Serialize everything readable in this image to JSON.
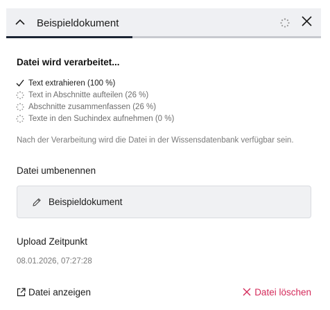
{
  "header": {
    "title": "Beispieldokument",
    "progress": 0.4,
    "icons": {
      "collapse": "chevron-up-icon",
      "status": "loading-spinner-icon",
      "close": "close-icon"
    }
  },
  "processing": {
    "title": "Datei wird verarbeitet...",
    "steps": [
      {
        "label": "Text extrahieren (100 %)",
        "status": "done",
        "icon": "checkmark-icon"
      },
      {
        "label": "Text in Abschnitte aufteilen (26 %)",
        "status": "pending",
        "icon": "loading-spinner-icon"
      },
      {
        "label": "Abschnitte zusammenfassen (26 %)",
        "status": "pending",
        "icon": "loading-spinner-icon"
      },
      {
        "label": "Texte in den Suchindex aufnehmen (0 %)",
        "status": "pending",
        "icon": "loading-spinner-icon"
      }
    ],
    "note": "Nach der Verarbeitung wird die Datei in der Wissensdatenbank verfügbar sein."
  },
  "rename": {
    "label": "Datei umbenennen",
    "value": "Beispieldokument",
    "icon": "pencil-icon"
  },
  "upload": {
    "label": "Upload Zeitpunkt",
    "value": "08.01.2026, 07:27:28"
  },
  "actions": {
    "view_label": "Datei anzeigen",
    "view_icon": "external-link-icon",
    "delete_label": "Datei löschen",
    "delete_icon": "close-icon"
  },
  "colors": {
    "header_bg": "#eff0f3",
    "progress_fill": "#1b2434",
    "danger": "#d42a5a"
  }
}
